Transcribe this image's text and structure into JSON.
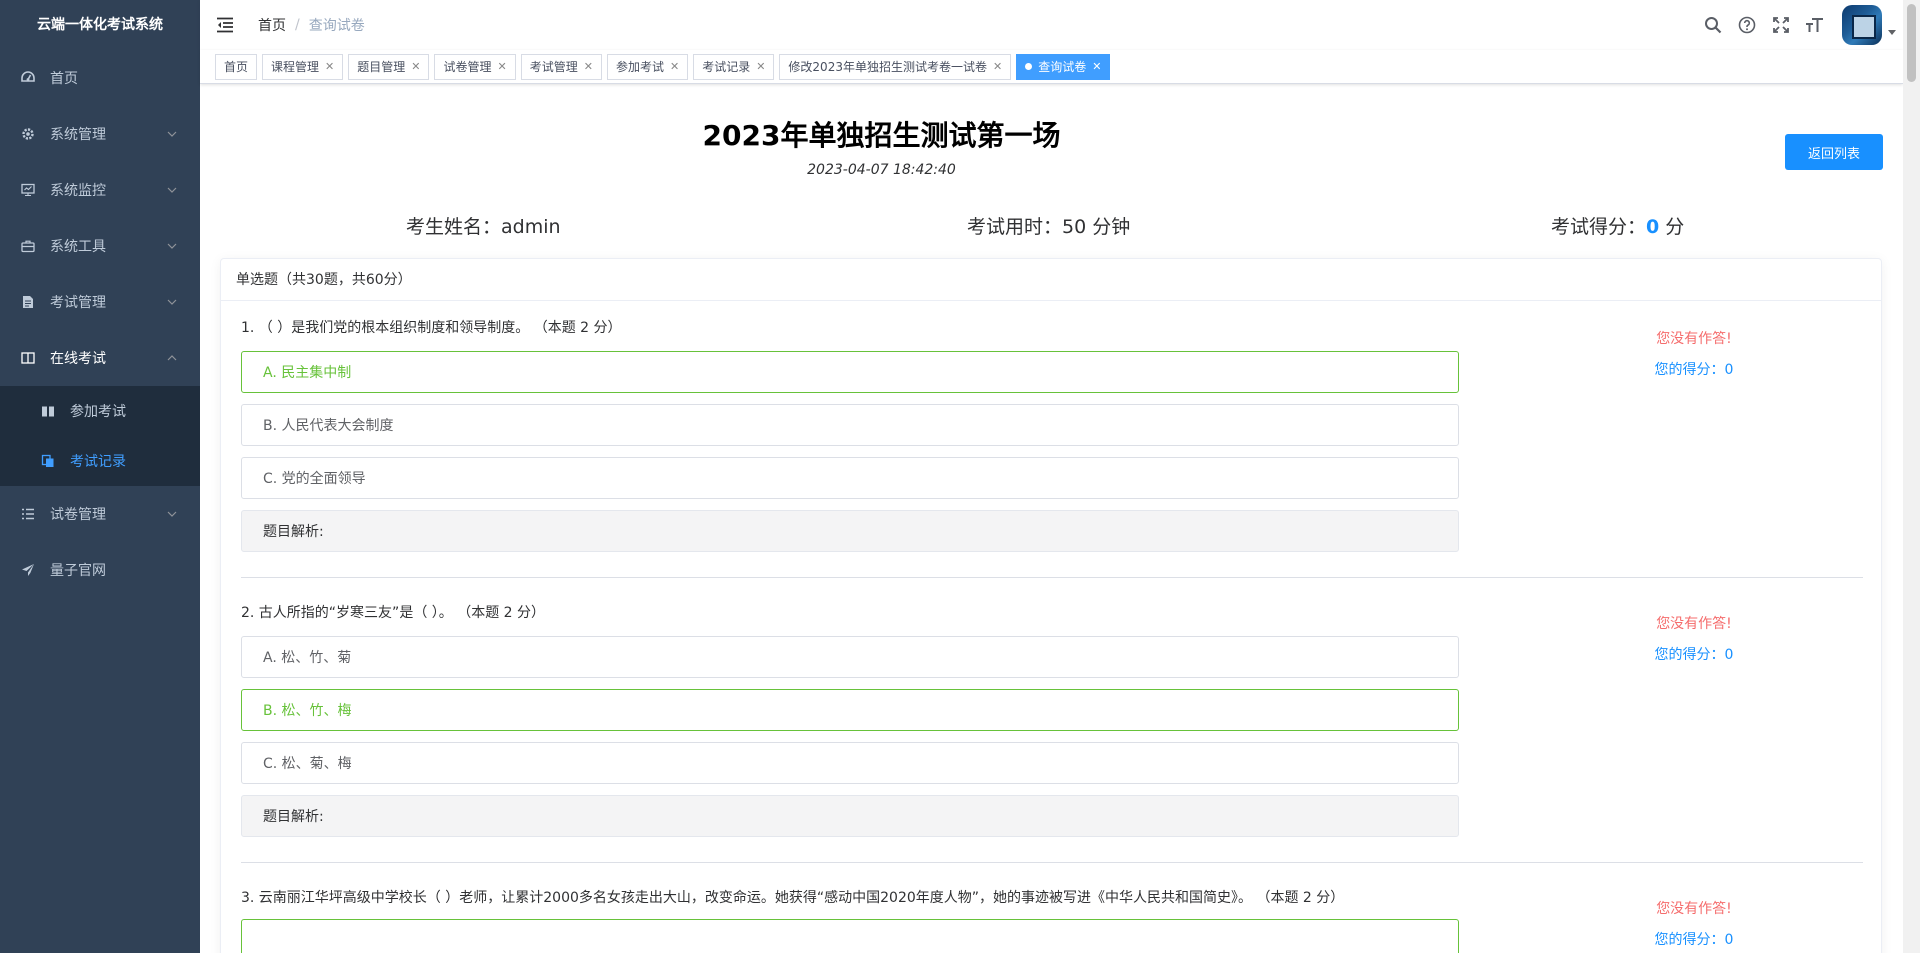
{
  "app": {
    "title": "云端一体化考试系统"
  },
  "sidebar": {
    "items": [
      {
        "label": "首页",
        "icon": "dashboard-icon"
      },
      {
        "label": "系统管理",
        "icon": "gear-icon"
      },
      {
        "label": "系统监控",
        "icon": "monitor-icon"
      },
      {
        "label": "系统工具",
        "icon": "toolbox-icon"
      },
      {
        "label": "考试管理",
        "icon": "document-icon"
      },
      {
        "label": "在线考试",
        "icon": "book-icon",
        "open": true
      },
      {
        "label": "试卷管理",
        "icon": "list-icon"
      },
      {
        "label": "量子官网",
        "icon": "send-icon"
      }
    ],
    "submenu": [
      {
        "label": "参加考试",
        "icon": "book-open-icon"
      },
      {
        "label": "考试记录",
        "icon": "copy-icon",
        "active": true
      }
    ]
  },
  "navbar": {
    "breadcrumb": {
      "home": "首页",
      "current": "查询试卷"
    },
    "icons": [
      "search-icon",
      "question-icon",
      "fullscreen-icon",
      "font-size-icon"
    ]
  },
  "tags": [
    {
      "label": "首页",
      "closable": false
    },
    {
      "label": "课程管理",
      "closable": true
    },
    {
      "label": "题目管理",
      "closable": true
    },
    {
      "label": "试卷管理",
      "closable": true
    },
    {
      "label": "考试管理",
      "closable": true
    },
    {
      "label": "参加考试",
      "closable": true
    },
    {
      "label": "考试记录",
      "closable": true
    },
    {
      "label": "修改2023年单独招生测试考卷一试卷",
      "closable": true
    },
    {
      "label": "查询试卷",
      "closable": true,
      "active": true
    }
  ],
  "exam": {
    "title": "2023年单独招生测试第一场",
    "date": "2023-04-07 18:42:40",
    "back_label": "返回列表",
    "student_label": "考生姓名：",
    "student_name": "admin",
    "duration_label": "考试用时：",
    "duration_value": "50 分钟",
    "score_label": "考试得分：",
    "score_value": "0",
    "score_unit": " 分",
    "section_header": "单选题（共30题，共60分）"
  },
  "questions": [
    {
      "text": "1.  （ ）是我们党的根本组织制度和领导制度。 （本题 2 分）",
      "options": [
        {
          "text": "A. 民主集中制",
          "correct": true
        },
        {
          "text": "B. 人民代表大会制度",
          "correct": false
        },
        {
          "text": "C. 党的全面领导",
          "correct": false
        }
      ],
      "analysis_label": "题目解析:",
      "no_answer": "您没有作答!",
      "score_text": "您的得分：0"
    },
    {
      "text": "2.  古人所指的“岁寒三友”是（ ）。 （本题 2 分）",
      "options": [
        {
          "text": "A. 松、竹、菊",
          "correct": false
        },
        {
          "text": "B. 松、竹、梅",
          "correct": true
        },
        {
          "text": "C. 松、菊、梅",
          "correct": false
        }
      ],
      "analysis_label": "题目解析:",
      "no_answer": "您没有作答!",
      "score_text": "您的得分：0"
    },
    {
      "text": "3.  云南丽江华坪高级中学校长（ ）老师，让累计2000多名女孩走出大山，改变命运。她获得“感动中国2020年度人物”，她的事迹被写进《中华人民共和国简史》。 （本题 2 分）",
      "options": [],
      "analysis_label": "",
      "no_answer": "您没有作答!",
      "score_text": "您的得分：0"
    }
  ]
}
